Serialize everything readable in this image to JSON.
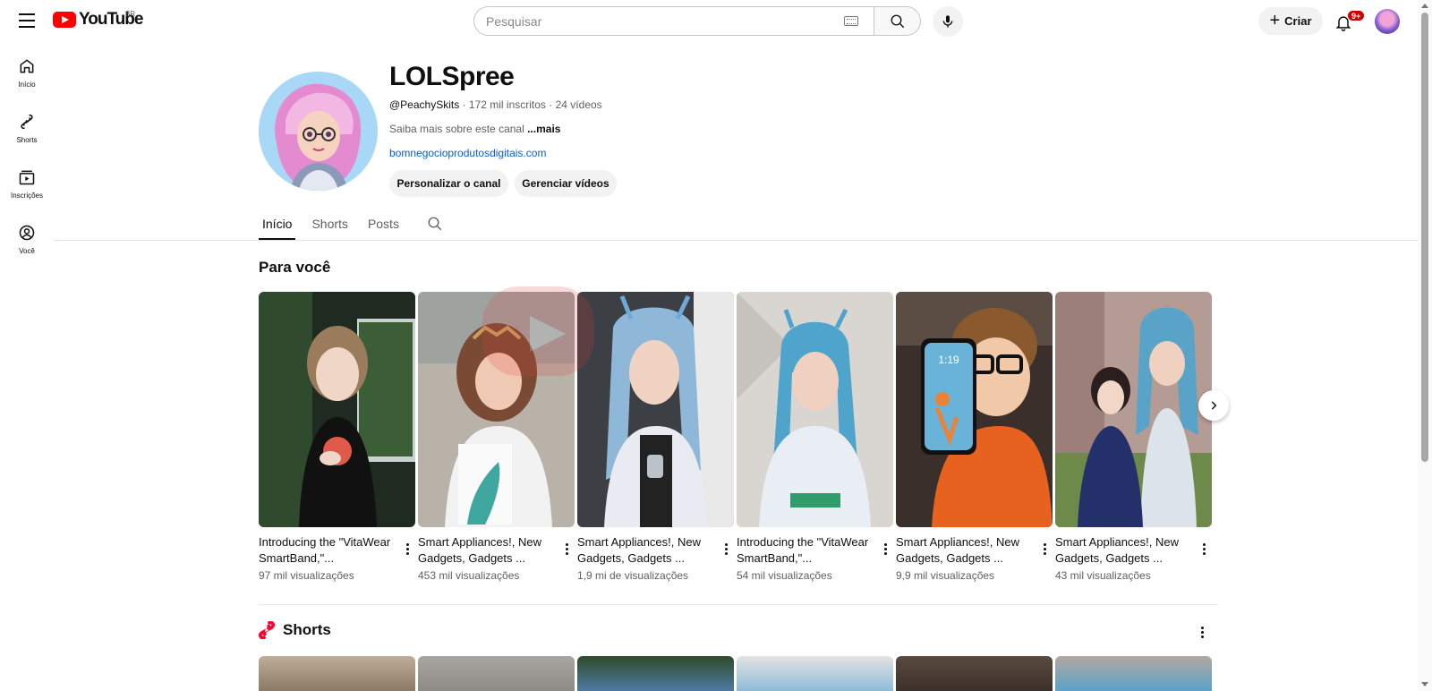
{
  "topbar": {
    "logo_text": "YouTube",
    "country": "BR",
    "search_placeholder": "Pesquisar",
    "create_label": "Criar",
    "notifications_badge": "9+"
  },
  "sidenav": {
    "items": [
      {
        "label": "Início",
        "icon": "home-icon"
      },
      {
        "label": "Shorts",
        "icon": "shorts-icon"
      },
      {
        "label": "Inscrições",
        "icon": "subscriptions-icon"
      },
      {
        "label": "Você",
        "icon": "you-icon"
      }
    ]
  },
  "channel": {
    "name": "LOLSpree",
    "handle": "@PeachySkits",
    "subscribers": "172 mil inscritos",
    "videos": "24 vídeos",
    "description": "Saiba mais sobre este canal",
    "description_more": "...mais",
    "link": "bomnegocioprodutosdigitais.com",
    "customize_label": "Personalizar o canal",
    "manage_label": "Gerenciar vídeos"
  },
  "tabs": [
    {
      "label": "Início",
      "active": true
    },
    {
      "label": "Shorts",
      "active": false
    },
    {
      "label": "Posts",
      "active": false
    }
  ],
  "for_you": {
    "title": "Para você",
    "videos": [
      {
        "title": "Introducing the \"VitaWear SmartBand,\"...",
        "views": "97 mil visualizações"
      },
      {
        "title": "Smart Appliances!, New Gadgets, Gadgets ...",
        "views": "453 mil visualizações"
      },
      {
        "title": "Smart Appliances!, New Gadgets, Gadgets ...",
        "views": "1,9 mi de visualizações"
      },
      {
        "title": "Introducing the \"VitaWear SmartBand,\"...",
        "views": "54 mil visualizações"
      },
      {
        "title": "Smart Appliances!, New Gadgets, Gadgets ...",
        "views": "9,9 mil visualizações"
      },
      {
        "title": "Smart Appliances!, New Gadgets, Gadgets ...",
        "views": "43 mil visualizações"
      }
    ],
    "phone_time": "1:19"
  },
  "shorts_section": {
    "title": "Shorts"
  },
  "colors": {
    "brand_red": "#ff0000",
    "link_blue": "#065fd4",
    "badge_red": "#cc0000"
  }
}
